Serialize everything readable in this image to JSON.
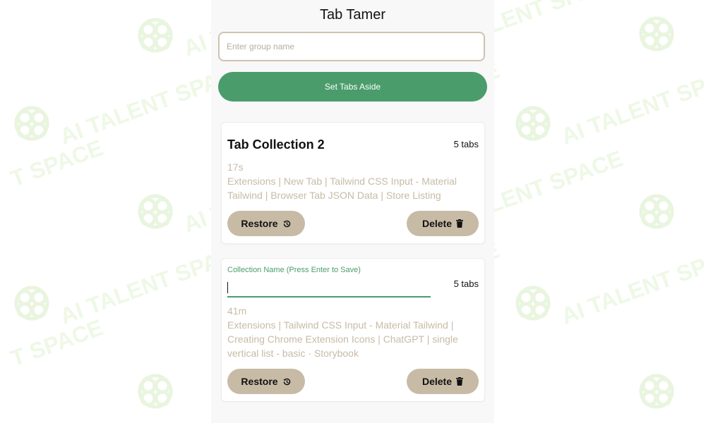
{
  "app": {
    "title": "Tab Tamer"
  },
  "group_input": {
    "placeholder": "Enter group name",
    "value": ""
  },
  "set_aside_button": {
    "label": "Set Tabs Aside"
  },
  "watermark": {
    "text": "AI TALENT SPACE",
    "partial_text": "T SPACE"
  },
  "collections": [
    {
      "title": "Tab Collection 2",
      "tab_count": "5 tabs",
      "time_ago": "17s",
      "tabs_text": "Extensions | New Tab | Tailwind CSS Input - Material Tailwind | Browser Tab JSON Data | Store Listing",
      "restore_label": "Restore",
      "delete_label": "Delete"
    },
    {
      "edit_label": "Collection Name (Press Enter to Save)",
      "edit_value": "",
      "tab_count": "5 tabs",
      "time_ago": "41m",
      "tabs_text": "Extensions | Tailwind CSS Input - Material Tailwind | Creating Chrome Extension Icons | ChatGPT | single vertical list - basic · Storybook",
      "restore_label": "Restore",
      "delete_label": "Delete"
    }
  ],
  "colors": {
    "accent_green": "#4a9d6b",
    "tan": "#c7bba6",
    "input_border": "#cfc3ae",
    "panel_bg": "#f8f8f8",
    "watermark_green": "#eef8e6"
  },
  "icons": {
    "restore": "history-icon",
    "delete": "trash-icon"
  }
}
